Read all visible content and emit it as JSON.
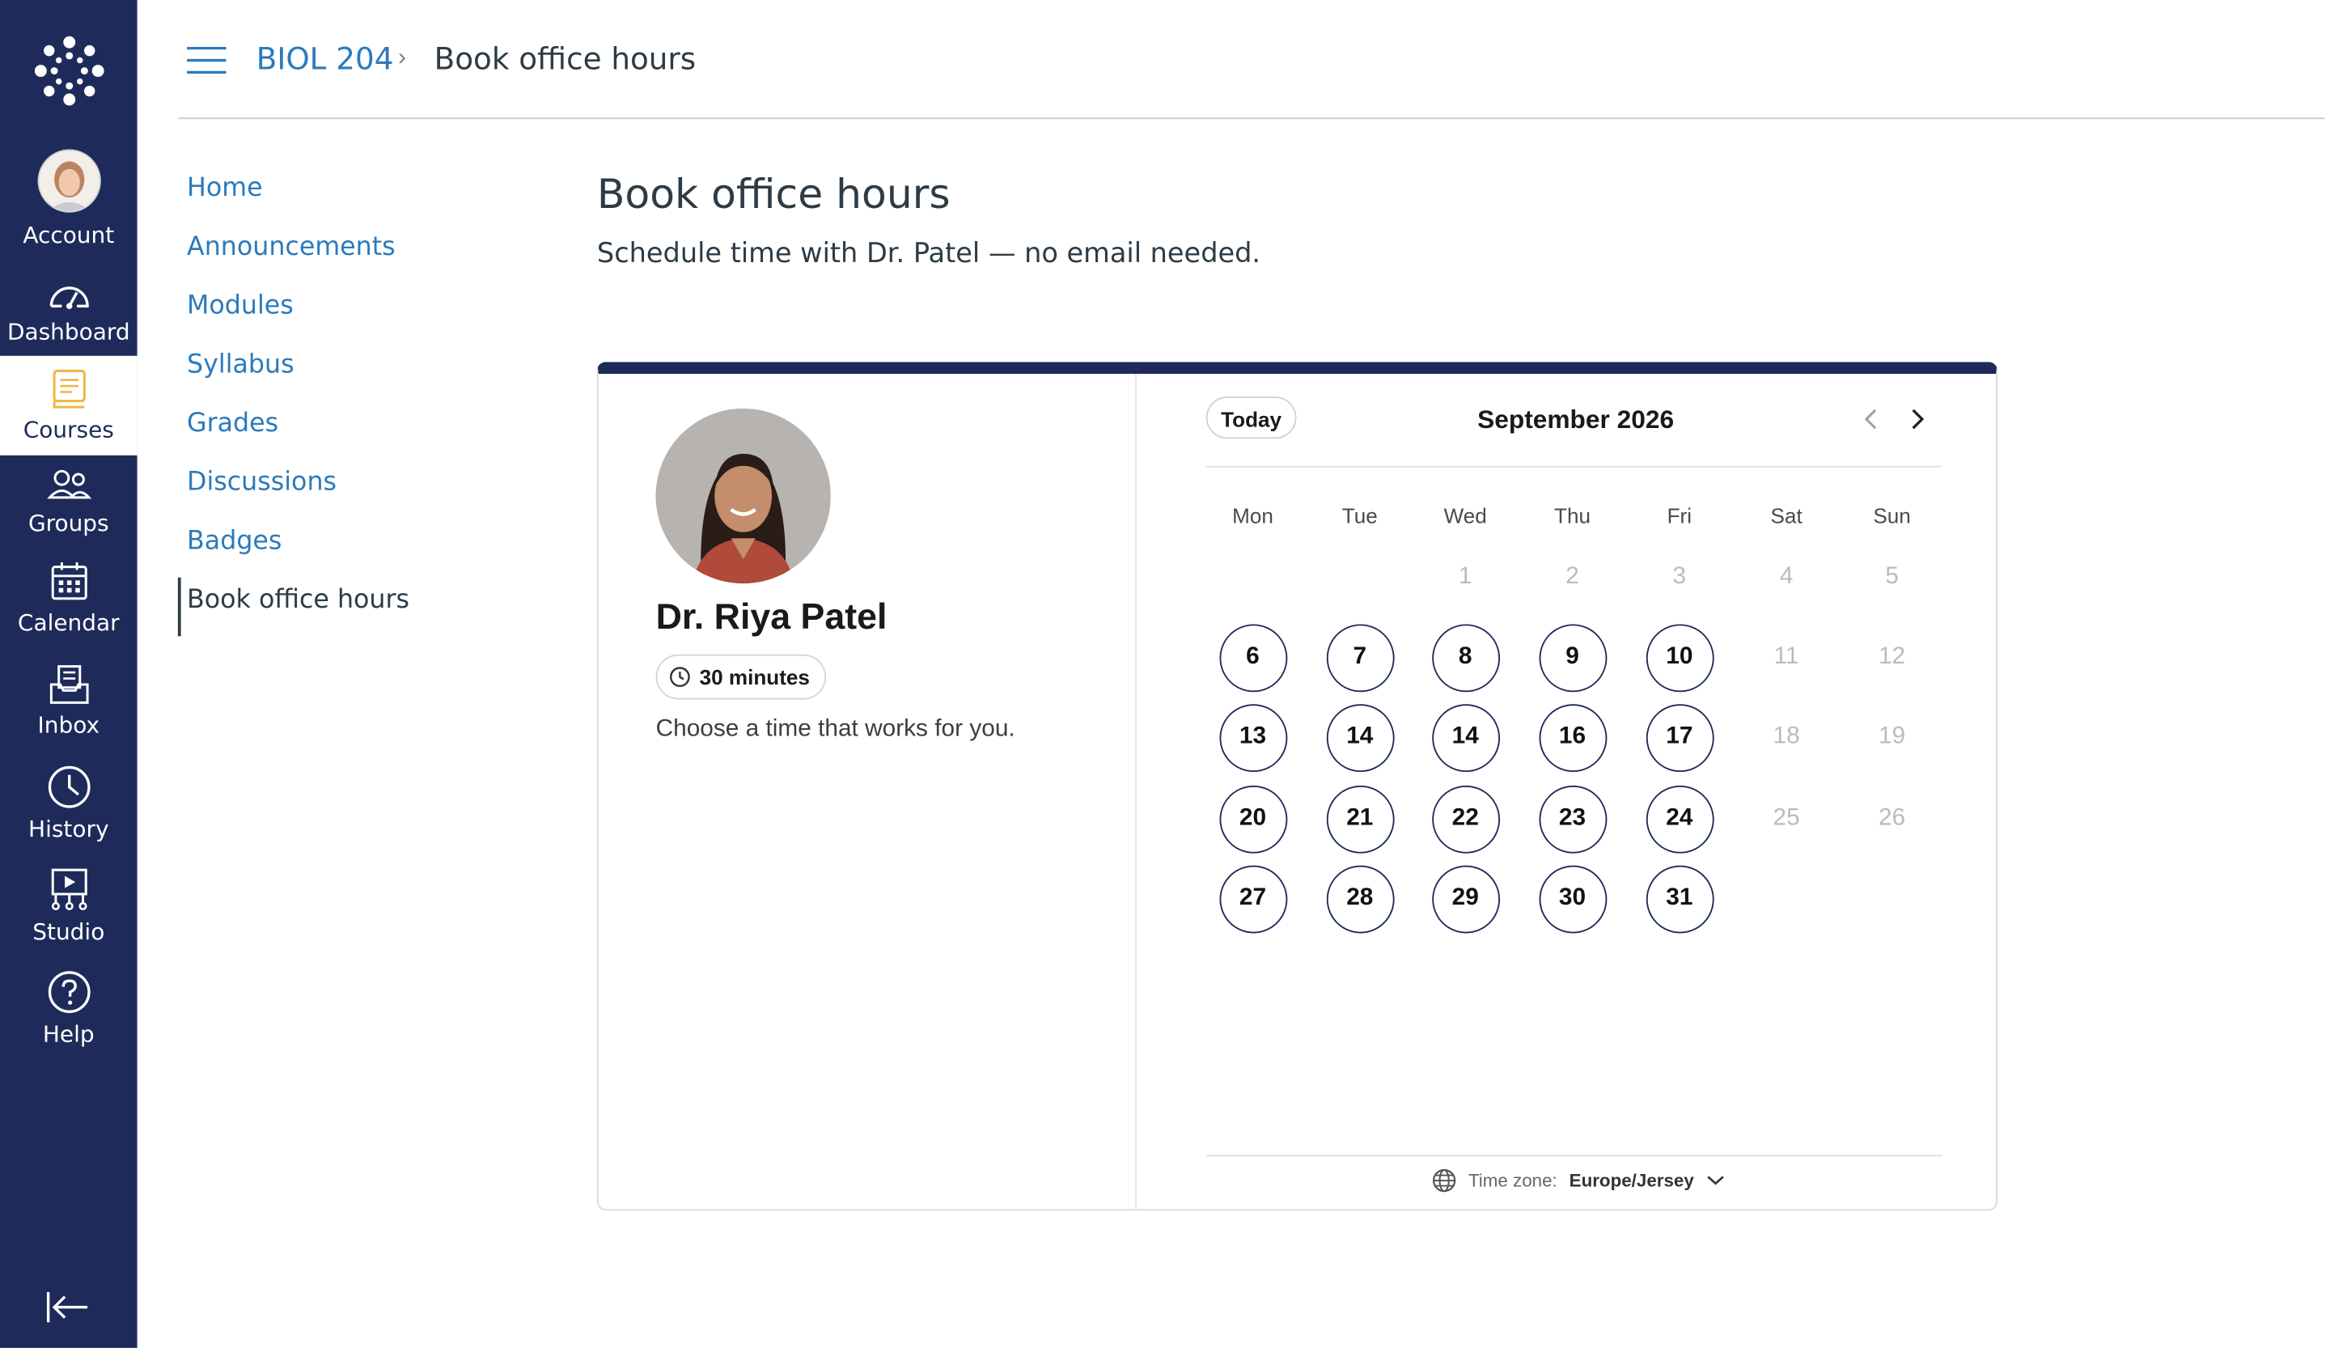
{
  "global_nav": {
    "items": [
      {
        "label": "Account"
      },
      {
        "label": "Dashboard"
      },
      {
        "label": "Courses"
      },
      {
        "label": "Groups"
      },
      {
        "label": "Calendar"
      },
      {
        "label": "Inbox"
      },
      {
        "label": "History"
      },
      {
        "label": "Studio"
      },
      {
        "label": "Help"
      }
    ],
    "active": "Courses",
    "colors": {
      "nav_bg": "#1e2b5a",
      "active_icon": "#f0b541"
    }
  },
  "breadcrumb": {
    "course": "BIOL 204",
    "separator": "›",
    "page": "Book office hours"
  },
  "course_nav": {
    "items": [
      {
        "label": "Home"
      },
      {
        "label": "Announcements"
      },
      {
        "label": "Modules"
      },
      {
        "label": "Syllabus"
      },
      {
        "label": "Grades"
      },
      {
        "label": "Discussions"
      },
      {
        "label": "Badges"
      },
      {
        "label": "Book office hours"
      }
    ],
    "active": "Book office hours"
  },
  "main": {
    "title": "Book office hours",
    "subtitle": "Schedule time with Dr. Patel — no email needed."
  },
  "booking": {
    "host_name": "Dr. Riya Patel",
    "duration": "30 minutes",
    "note": "Choose a time that works for you.",
    "calendar": {
      "today_label": "Today",
      "month": "September 2026",
      "weekdays": [
        "Mon",
        "Tue",
        "Wed",
        "Thu",
        "Fri",
        "Sat",
        "Sun"
      ],
      "weeks": [
        [
          null,
          null,
          {
            "d": "1",
            "available": false
          },
          {
            "d": "2",
            "available": false
          },
          {
            "d": "3",
            "available": false
          },
          {
            "d": "4",
            "available": false
          },
          {
            "d": "5",
            "available": false
          }
        ],
        [
          {
            "d": "6",
            "available": true
          },
          {
            "d": "7",
            "available": true
          },
          {
            "d": "8",
            "available": true
          },
          {
            "d": "9",
            "available": true
          },
          {
            "d": "10",
            "available": true
          },
          {
            "d": "11",
            "available": false
          },
          {
            "d": "12",
            "available": false
          }
        ],
        [
          {
            "d": "13",
            "available": true
          },
          {
            "d": "14",
            "available": true
          },
          {
            "d": "14",
            "available": true
          },
          {
            "d": "16",
            "available": true
          },
          {
            "d": "17",
            "available": true
          },
          {
            "d": "18",
            "available": false
          },
          {
            "d": "19",
            "available": false
          }
        ],
        [
          {
            "d": "20",
            "available": true
          },
          {
            "d": "21",
            "available": true
          },
          {
            "d": "22",
            "available": true
          },
          {
            "d": "23",
            "available": true
          },
          {
            "d": "24",
            "available": true
          },
          {
            "d": "25",
            "available": false
          },
          {
            "d": "26",
            "available": false
          }
        ],
        [
          {
            "d": "27",
            "available": true
          },
          {
            "d": "28",
            "available": true
          },
          {
            "d": "29",
            "available": true
          },
          {
            "d": "30",
            "available": true
          },
          {
            "d": "31",
            "available": true
          },
          null,
          null
        ]
      ]
    },
    "timezone_label": "Time zone:",
    "timezone_value": "Europe/Jersey",
    "accent_color": "#1e2b5a"
  }
}
